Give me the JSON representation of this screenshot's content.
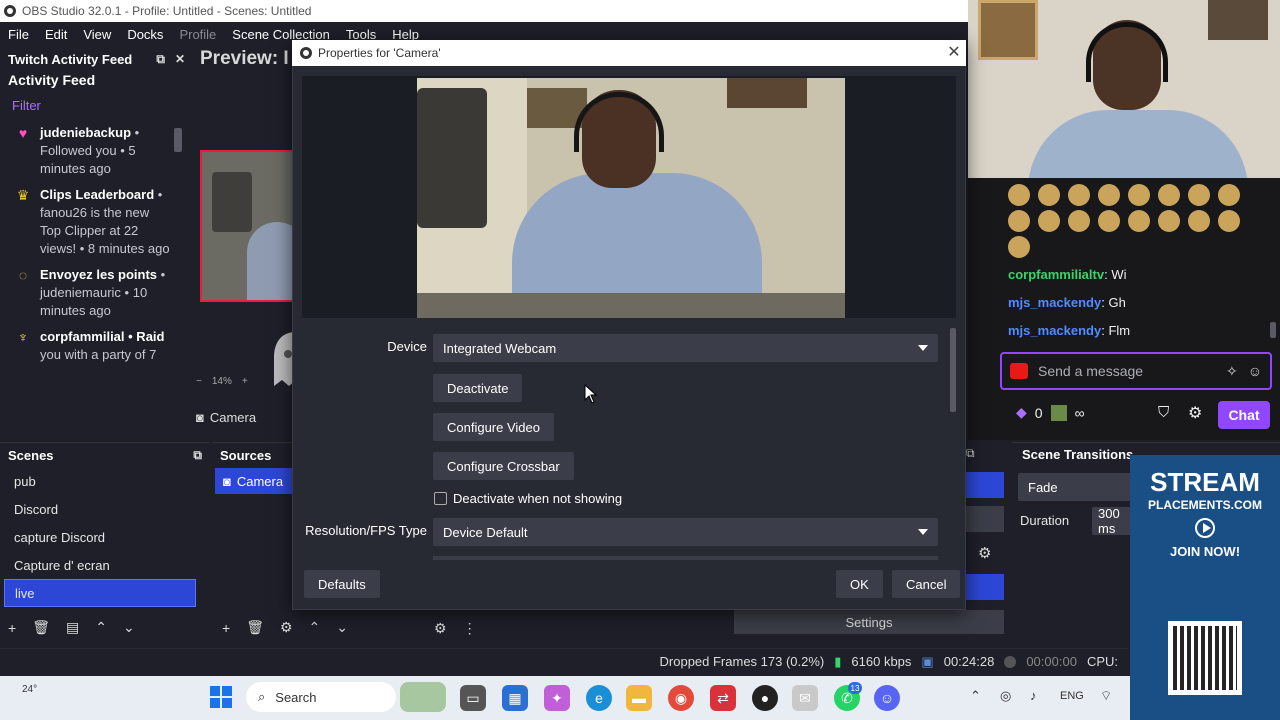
{
  "window": {
    "title": "OBS Studio 32.0.1 - Profile: Untitled - Scenes: Untitled"
  },
  "menu": [
    "File",
    "Edit",
    "View",
    "Docks",
    "Profile",
    "Scene Collection",
    "Tools",
    "Help"
  ],
  "feed": {
    "dock_title": "Twitch Activity Feed",
    "subtitle": "Activity Feed",
    "filter": "Filter",
    "items": [
      {
        "icon": "heart-icon",
        "glyph": "♥",
        "color": "#ff4fc3",
        "name": "judeniebackup",
        "text": " • Followed you • 5 minutes ago"
      },
      {
        "icon": "crown-icon",
        "glyph": "♛",
        "color": "#f3c43c",
        "name": "Clips Leaderboard",
        "text": " • fanou26 is the new Top Clipper at 22 views! • 8 minutes ago"
      },
      {
        "icon": "points-icon",
        "glyph": "◌",
        "color": "#f3c43c",
        "name": "Envoyez les points",
        "text": " • judeniemauric • 10 minutes ago"
      },
      {
        "icon": "raid-icon",
        "glyph": "♆",
        "color": "#f3e03c",
        "name": "corpfammilial • Raid",
        "text": " you with a party of 7"
      }
    ]
  },
  "preview": {
    "label": "Preview: I",
    "zoom": "14%",
    "source_label": "Camera"
  },
  "scenes": {
    "title": "Scenes",
    "items": [
      "pub",
      "Discord",
      "capture Discord",
      "Capture d' ecran",
      "live"
    ],
    "selected": 4
  },
  "sources": {
    "title": "Sources",
    "items": [
      "Camera"
    ]
  },
  "scene_transitions": {
    "title": "Scene Transitions",
    "transition": "Fade",
    "duration_label": "Duration",
    "duration_value": "300 ms"
  },
  "settings_label": "Settings",
  "chat": {
    "messages": [
      {
        "user": "corpfammilialtv",
        "color": "#36d66b",
        "text": ": Wi"
      },
      {
        "user": "mjs_mackendy",
        "color": "#4f8cff",
        "text": ": Gh"
      },
      {
        "user": "mjs_mackendy",
        "color": "#4f8cff",
        "text": ": Flm"
      }
    ],
    "placeholder": "Send a message",
    "points": "0",
    "infinity": "∞",
    "chat_button": "Chat"
  },
  "ad": {
    "line1": "STREAM",
    "line2": "PLACEMENTS.COM",
    "cta": "JOIN NOW!"
  },
  "status": {
    "dropped": "Dropped Frames 173 (0.2%)",
    "bitrate": "6160 kbps",
    "rec_time": "00:24:28",
    "stream_time": "00:00:00",
    "cpu": "CPU:"
  },
  "taskbar": {
    "weather": "24°",
    "search": "Search",
    "lang": "ENG",
    "badge_whatsapp": "13"
  },
  "dialog": {
    "title": "Properties for 'Camera'",
    "device_label": "Device",
    "device_value": "Integrated Webcam",
    "deactivate": "Deactivate",
    "configure_video": "Configure Video",
    "configure_crossbar": "Configure Crossbar",
    "deactivate_when_hidden": "Deactivate when not showing",
    "resfps_label": "Resolution/FPS Type",
    "resfps_value": "Device Default",
    "defaults": "Defaults",
    "ok": "OK",
    "cancel": "Cancel"
  },
  "colors": {
    "accent": "#2c47d6",
    "twitch": "#9147ff",
    "record_red": "#e81e3c"
  }
}
